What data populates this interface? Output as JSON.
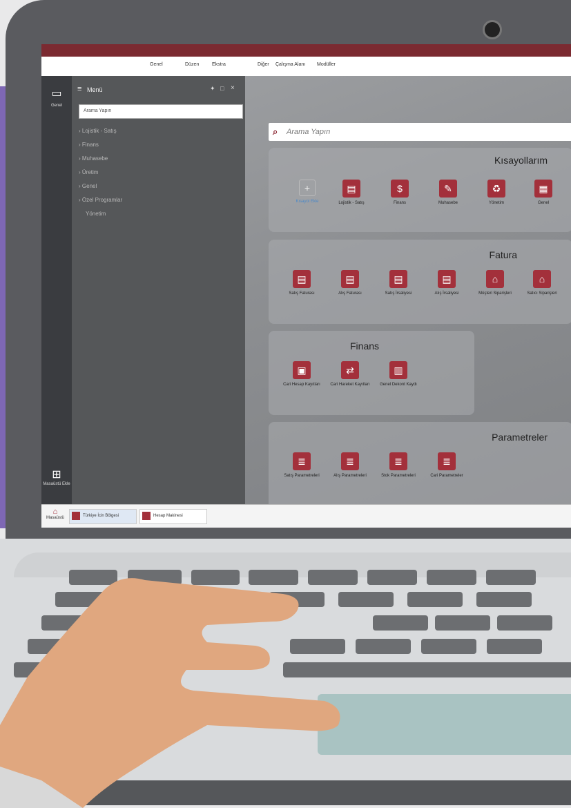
{
  "menubar": {
    "items": [
      "Genel",
      "Düzen",
      "Ekstra",
      "Diğer",
      "Çalışma Alanı",
      "Modüller"
    ]
  },
  "leftrail": {
    "top_label": "Genel",
    "bottom_label": "Masaüstü Ekle",
    "taskbar_home_label": "Masaüstü"
  },
  "menu_panel": {
    "title": "Menü",
    "search_placeholder": "Arama Yapın",
    "items": [
      "Lojistik - Satış",
      "Finans",
      "Muhasebe",
      "Üretim",
      "Genel",
      "Özel Programlar",
      "Yönetim"
    ]
  },
  "main": {
    "search_placeholder": "Arama Yapın",
    "groups": [
      {
        "title": "Kısayollarım",
        "tiles": [
          "Lojistik - Satış",
          "Finans",
          "Muhasebe",
          "Yönetim",
          "Genel"
        ],
        "add_label": "Kısayol Ekle"
      },
      {
        "title": "Fatura",
        "tiles": [
          "Satış Faturası",
          "Alış Faturası",
          "Satış İrsaliyesi",
          "Alış İrsaliyesi",
          "Müşteri Siparişleri",
          "Satıcı Siparişleri"
        ]
      },
      {
        "title": "Finans",
        "tiles": [
          "Cari Hesap Kayıtları",
          "Cari Hareket Kayıtları",
          "Genel Dekont Kaydı"
        ]
      },
      {
        "title": "Parametreler",
        "tiles": [
          "Satış Parametreleri",
          "Alış Parametreleri",
          "Stok Parametreleri",
          "Cari Parametreler"
        ]
      }
    ]
  },
  "taskbar": {
    "items": [
      "Türkiye İcin Bölgesi",
      "Hesap Makinesi"
    ]
  },
  "colors": {
    "brand": "#7b2a31",
    "tile": "#a3303b",
    "accent_purple": "#7e67b4"
  }
}
